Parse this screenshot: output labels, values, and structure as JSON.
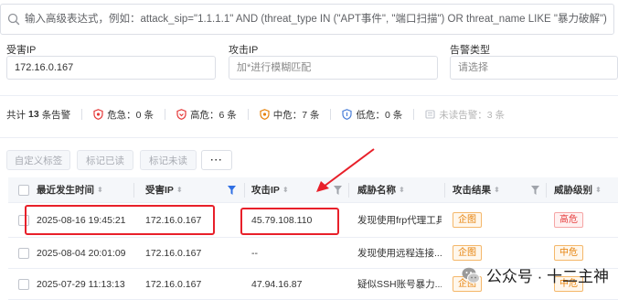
{
  "search": {
    "icon": "search-icon",
    "placeholder": "输入高级表达式，例如：attack_sip=\"1.1.1.1\" AND (threat_type IN (\"APT事件\", \"端口扫描\") OR threat_name LIKE \"暴力破解\")"
  },
  "filters": {
    "victim_ip": {
      "label": "受害IP",
      "value": "172.16.0.167"
    },
    "attack_ip": {
      "label": "攻击IP",
      "placeholder": "加*进行模糊匹配"
    },
    "alert_type": {
      "label": "告警类型",
      "placeholder": "请选择"
    }
  },
  "stats": {
    "prefix": "共计",
    "total": "13",
    "suffix": "条告警",
    "items": [
      {
        "icon": "critical-shield-icon",
        "color": "#e53a3a",
        "label": "危急：0 条"
      },
      {
        "icon": "high-shield-icon",
        "color": "#e53a3a",
        "label": "高危：6 条"
      },
      {
        "icon": "medium-shield-icon",
        "color": "#e6820a",
        "label": "中危：7 条"
      },
      {
        "icon": "low-shield-icon",
        "color": "#4a7fd8",
        "label": "低危：0 条"
      }
    ],
    "unread": {
      "icon": "unread-icon",
      "label": "未读告警：3 条"
    }
  },
  "toolbar": {
    "custom_tag": "自定义标签",
    "mark_read": "标记已读",
    "mark_unread": "标记未读",
    "more": "···"
  },
  "table": {
    "columns": [
      "最近发生时间",
      "受害IP",
      "攻击IP",
      "威胁名称",
      "攻击结果",
      "威胁级别"
    ],
    "rows": [
      {
        "time": "2025-08-16 19:45:21",
        "victim_ip": "172.16.0.167",
        "attack_ip": "45.79.108.110",
        "threat": "发现使用frp代理工具",
        "result": "企图",
        "level": "高危"
      },
      {
        "time": "2025-08-04 20:01:09",
        "victim_ip": "172.16.0.167",
        "attack_ip": "--",
        "threat": "发现使用远程连接...",
        "result": "企图",
        "level": "中危"
      },
      {
        "time": "2025-07-29 11:13:13",
        "victim_ip": "172.16.0.167",
        "attack_ip": "47.94.16.87",
        "threat": "疑似SSH账号暴力...",
        "result": "企图",
        "level": "中危"
      }
    ]
  },
  "watermark": {
    "icon": "wechat-logo-icon",
    "text": "公众号 · 十二主神"
  },
  "colors": {
    "highlight": "#e8202a",
    "accent_blue": "#4a7fd8"
  }
}
